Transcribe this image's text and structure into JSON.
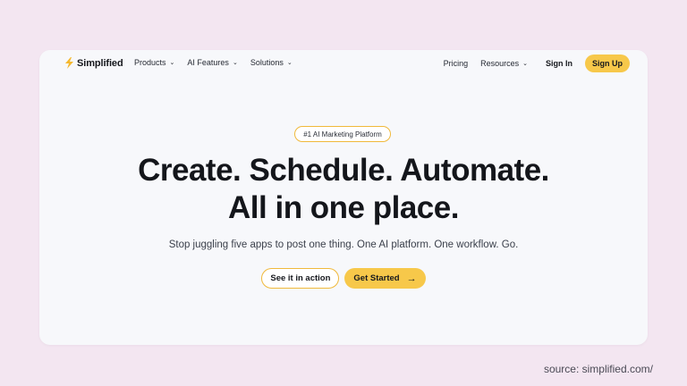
{
  "nav": {
    "logo_text": "Simplified",
    "items_left": [
      {
        "label": "Products",
        "icon": "chevron-down-icon"
      },
      {
        "label": "AI Features",
        "icon": "chevron-down-icon"
      },
      {
        "label": "Solutions",
        "icon": "chevron-down-icon"
      }
    ],
    "pricing": "Pricing",
    "resources": "Resources",
    "sign_in": "Sign In",
    "sign_up": "Sign Up"
  },
  "hero": {
    "badge": "#1 AI Marketing Platform",
    "headline_line1": "Create. Schedule. Automate.",
    "headline_line2": "All in one place.",
    "subheadline": "Stop juggling five apps to post one thing. One AI platform. One workflow. Go.",
    "cta_secondary": "See it in action",
    "cta_primary": "Get Started"
  },
  "source": "source: simplified.com/",
  "colors": {
    "accent": "#f7c84a",
    "accent_border": "#f0b93b",
    "background": "#f3e6f1",
    "card": "#f7f8fb",
    "text": "#14161b"
  }
}
